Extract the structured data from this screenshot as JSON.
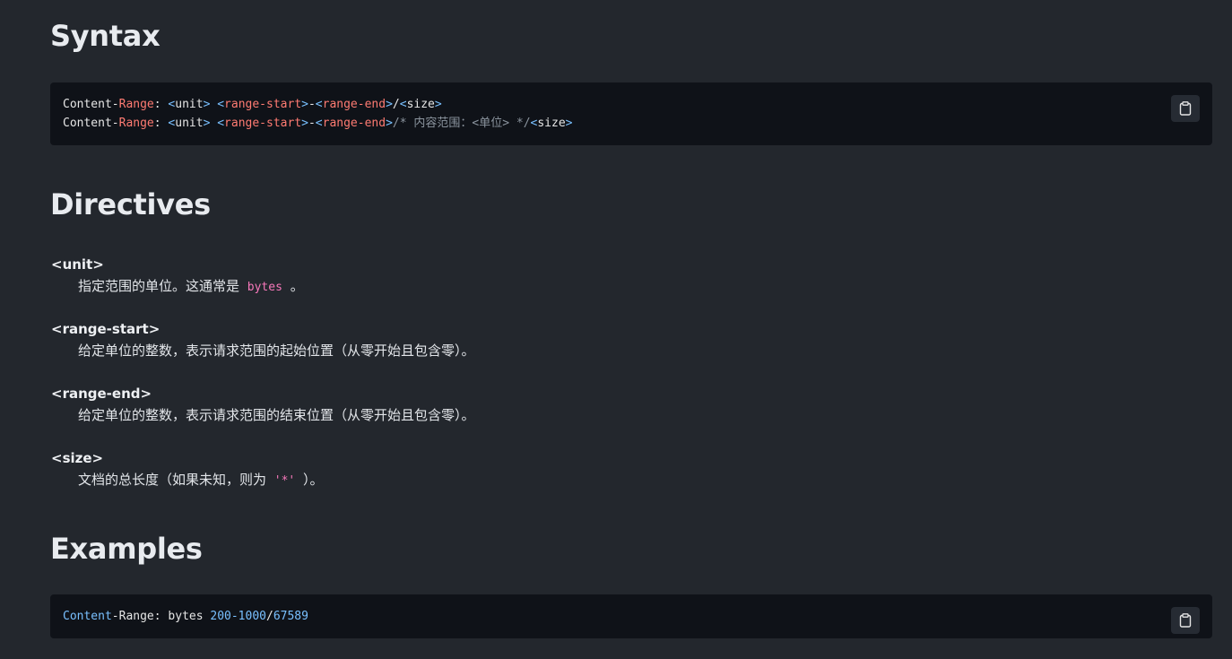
{
  "sections": {
    "syntax": {
      "heading": "Syntax",
      "code_lines": [
        {
          "tokens": [
            {
              "text": "Content-",
              "cls": ""
            },
            {
              "text": "Range",
              "cls": "tok-kw"
            },
            {
              "text": ": ",
              "cls": ""
            },
            {
              "text": "<",
              "cls": "tok-pun"
            },
            {
              "text": "unit",
              "cls": ""
            },
            {
              "text": ">",
              "cls": "tok-pun"
            },
            {
              "text": " ",
              "cls": ""
            },
            {
              "text": "<",
              "cls": "tok-pun"
            },
            {
              "text": "range-start",
              "cls": "tok-attr"
            },
            {
              "text": ">",
              "cls": "tok-pun"
            },
            {
              "text": "-",
              "cls": ""
            },
            {
              "text": "<",
              "cls": "tok-pun"
            },
            {
              "text": "range-end",
              "cls": "tok-attr"
            },
            {
              "text": ">",
              "cls": "tok-pun"
            },
            {
              "text": "/",
              "cls": ""
            },
            {
              "text": "<",
              "cls": "tok-pun"
            },
            {
              "text": "size",
              "cls": ""
            },
            {
              "text": ">",
              "cls": "tok-pun"
            }
          ]
        },
        {
          "tokens": [
            {
              "text": "Content-",
              "cls": ""
            },
            {
              "text": "Range",
              "cls": "tok-kw"
            },
            {
              "text": ": ",
              "cls": ""
            },
            {
              "text": "<",
              "cls": "tok-pun"
            },
            {
              "text": "unit",
              "cls": ""
            },
            {
              "text": ">",
              "cls": "tok-pun"
            },
            {
              "text": " ",
              "cls": ""
            },
            {
              "text": "<",
              "cls": "tok-pun"
            },
            {
              "text": "range-start",
              "cls": "tok-attr"
            },
            {
              "text": ">",
              "cls": "tok-pun"
            },
            {
              "text": "-",
              "cls": ""
            },
            {
              "text": "<",
              "cls": "tok-pun"
            },
            {
              "text": "range-end",
              "cls": "tok-attr"
            },
            {
              "text": ">",
              "cls": "tok-pun"
            },
            {
              "text": "/* 内容范围：<单位> */",
              "cls": "tok-com"
            },
            {
              "text": "<",
              "cls": "tok-pun"
            },
            {
              "text": "size",
              "cls": ""
            },
            {
              "text": ">",
              "cls": "tok-pun"
            }
          ]
        }
      ]
    },
    "directives": {
      "heading": "Directives",
      "items": [
        {
          "term": "<unit>",
          "desc_before": "指定范围的单位。这通常是 ",
          "code": "bytes",
          "desc_after": " 。"
        },
        {
          "term": "<range-start>",
          "desc_before": "给定单位的整数，表示请求范围的起始位置（从零开始且包含零）。",
          "code": "",
          "desc_after": ""
        },
        {
          "term": "<range-end>",
          "desc_before": "给定单位的整数，表示请求范围的结束位置（从零开始且包含零）。",
          "code": "",
          "desc_after": ""
        },
        {
          "term": "<size>",
          "desc_before": "文档的总长度（如果未知，则为 ",
          "code": "'*'",
          "desc_after": " ）。"
        }
      ]
    },
    "examples": {
      "heading": "Examples",
      "code_lines": [
        {
          "tokens": [
            {
              "text": "Content",
              "cls": "tok-blue"
            },
            {
              "text": "-Range: bytes ",
              "cls": ""
            },
            {
              "text": "200-1000",
              "cls": "tok-num"
            },
            {
              "text": "/",
              "cls": ""
            },
            {
              "text": "67589",
              "cls": "tok-num"
            }
          ]
        }
      ]
    }
  },
  "icons": {
    "copy": "clipboard-icon"
  },
  "colors": {
    "background": "#23272d",
    "code_background": "#0f1218",
    "keyword": "#ff7b72",
    "punctuation": "#79c0ff",
    "comment": "#8b949e",
    "inline_code": "#f778ba"
  }
}
